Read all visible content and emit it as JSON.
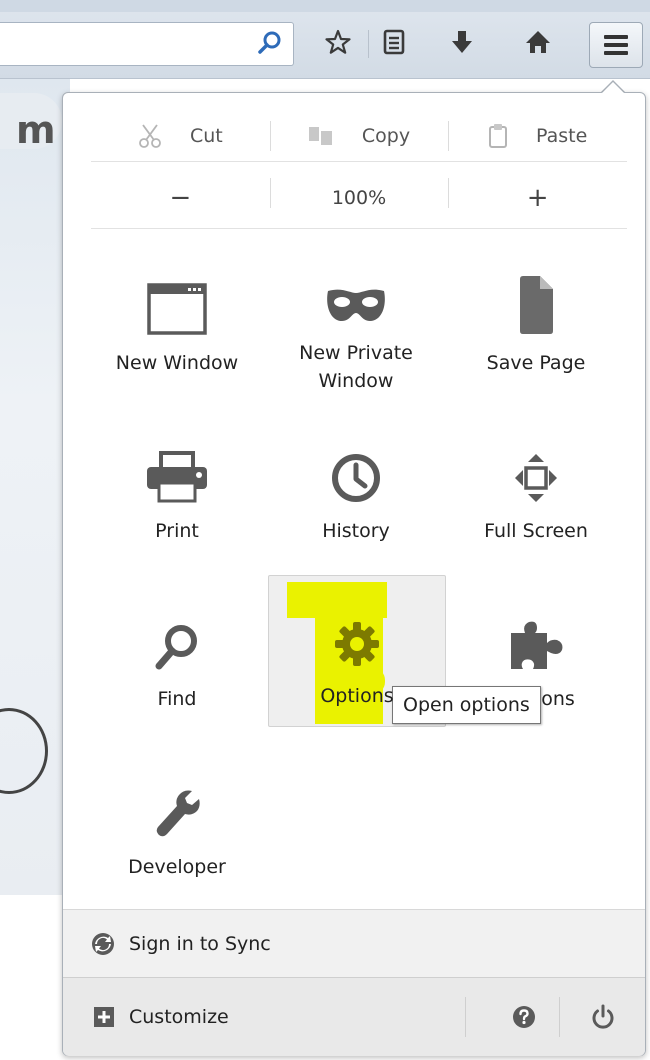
{
  "menu": {
    "cut": "Cut",
    "copy": "Copy",
    "paste": "Paste",
    "zoom_out": "−",
    "zoom_level": "100%",
    "zoom_in": "+",
    "items": {
      "new_window": "New Window",
      "new_private_1": "New Private",
      "new_private_2": "Window",
      "save_page": "Save Page",
      "print": "Print",
      "history": "History",
      "full_screen": "Full Screen",
      "find": "Find",
      "options": "Options",
      "addons": "Add-ons",
      "developer": "Developer"
    },
    "tooltip": "Open options",
    "sync": "Sign in to Sync",
    "customize": "Customize"
  },
  "colors": {
    "highlight": "#eaf200",
    "icon_gray": "#5a5a5a",
    "gear_highlighted": "#7d7a00",
    "search_blue": "#2e6bb8"
  },
  "icons": [
    "search-icon",
    "star-icon",
    "reading-list-icon",
    "download-icon",
    "home-icon",
    "hamburger-icon",
    "scissors-icon",
    "copy-icon",
    "clipboard-icon",
    "window-icon",
    "mask-icon",
    "page-icon",
    "printer-icon",
    "clock-icon",
    "fullscreen-icon",
    "magnifier-icon",
    "gear-icon",
    "puzzle-icon",
    "wrench-icon",
    "sync-icon",
    "plus-box-icon",
    "help-icon",
    "power-icon"
  ]
}
